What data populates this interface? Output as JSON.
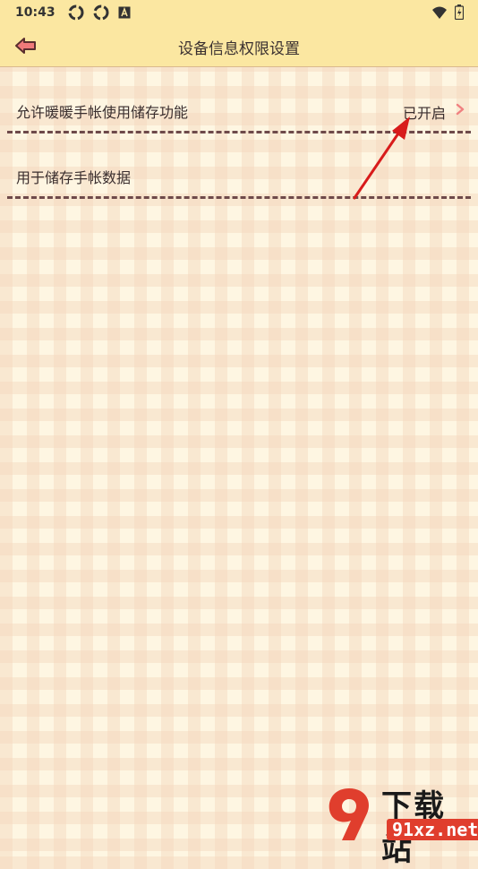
{
  "status_bar": {
    "time": "10:43",
    "left_icons": [
      "sync-icon",
      "sync-icon",
      "font-icon"
    ],
    "right_icons": [
      "wifi-icon",
      "battery-icon"
    ]
  },
  "header": {
    "title": "设备信息权限设置",
    "back_icon": "back-arrow-icon"
  },
  "settings": [
    {
      "label": "允许暖暖手帐使用储存功能",
      "value": "已开启"
    },
    {
      "label": "用于储存手帐数据"
    }
  ],
  "watermark": {
    "title": "下载站",
    "url": "91xz.net"
  },
  "colors": {
    "header_bg": "#fbe7a1",
    "text": "#3a2e2e",
    "chevron": "#f08080",
    "arrow": "#d81b1b",
    "divider": "#6e4a4a",
    "watermark_red": "#e03e2d"
  }
}
